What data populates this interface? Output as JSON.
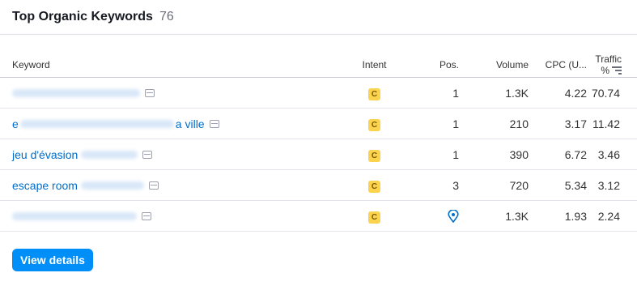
{
  "header": {
    "title": "Top Organic Keywords",
    "count": "76"
  },
  "table": {
    "columns": {
      "keyword": "Keyword",
      "intent": "Intent",
      "pos": "Pos.",
      "volume": "Volume",
      "cpc": "CPC (U...",
      "traffic": "Traffic %"
    },
    "rows": [
      {
        "keyword_visible": "",
        "intent": "C",
        "pos": "1",
        "volume": "1.3K",
        "cpc": "4.22",
        "traffic": "70.74"
      },
      {
        "keyword_visible": "e",
        "keyword_suffix": "a ville",
        "intent": "C",
        "pos": "1",
        "volume": "210",
        "cpc": "3.17",
        "traffic": "11.42"
      },
      {
        "keyword_visible": "jeu d'évasion",
        "intent": "C",
        "pos": "1",
        "volume": "390",
        "cpc": "6.72",
        "traffic": "3.46"
      },
      {
        "keyword_visible": "escape room",
        "intent": "C",
        "pos": "3",
        "volume": "720",
        "cpc": "5.34",
        "traffic": "3.12"
      },
      {
        "keyword_visible": "",
        "intent": "C",
        "pos_icon": "location-pin-icon",
        "volume": "1.3K",
        "cpc": "1.93",
        "traffic": "2.24"
      }
    ]
  },
  "button": {
    "view_details": "View details"
  },
  "colors": {
    "link": "#006dca",
    "button": "#008ff8",
    "intent_badge": "#fcd34d"
  }
}
